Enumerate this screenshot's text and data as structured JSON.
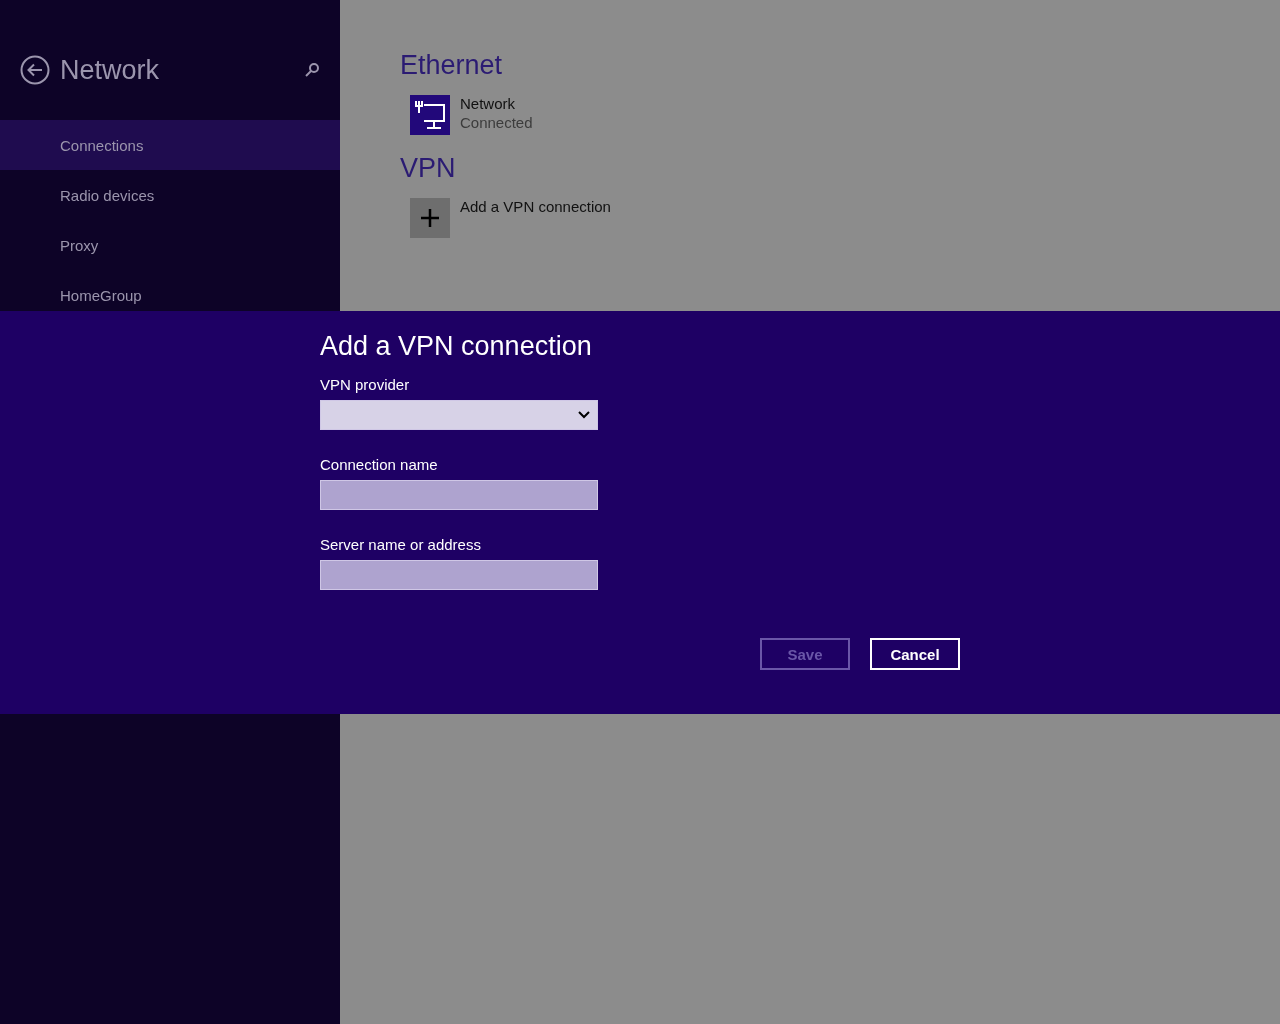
{
  "sidebar": {
    "title": "Network",
    "items": [
      {
        "label": "Connections",
        "selected": true
      },
      {
        "label": "Radio devices",
        "selected": false
      },
      {
        "label": "Proxy",
        "selected": false
      },
      {
        "label": "HomeGroup",
        "selected": false
      }
    ]
  },
  "content": {
    "sections": [
      {
        "heading": "Ethernet",
        "items": [
          {
            "kind": "network",
            "name": "Network",
            "status": "Connected"
          }
        ]
      },
      {
        "heading": "VPN",
        "items": [
          {
            "kind": "add",
            "name": "Add a VPN connection"
          }
        ]
      }
    ]
  },
  "dialog": {
    "title": "Add a VPN connection",
    "fields": [
      {
        "kind": "dropdown",
        "label": "VPN provider"
      },
      {
        "kind": "text",
        "label": "Connection name"
      },
      {
        "kind": "text",
        "label": "Server name or address"
      }
    ],
    "buttons": [
      {
        "label": "Save",
        "disabled": true
      },
      {
        "label": "Cancel",
        "disabled": false
      }
    ]
  }
}
